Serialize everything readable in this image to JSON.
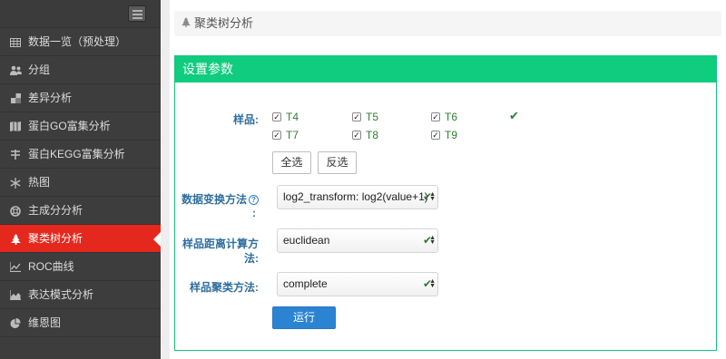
{
  "sidebar": {
    "toggle_icon": "menu-icon",
    "items": [
      {
        "label": "数据一览（预处理）",
        "icon": "table-icon"
      },
      {
        "label": "分组",
        "icon": "users-icon"
      },
      {
        "label": "差异分析",
        "icon": "puzzle-icon"
      },
      {
        "label": "蛋白GO富集分析",
        "icon": "map-icon"
      },
      {
        "label": "蛋白KEGG富集分析",
        "icon": "pathway-icon"
      },
      {
        "label": "热图",
        "icon": "snowflake-icon"
      },
      {
        "label": "主成分分析",
        "icon": "lifebuoy-icon"
      },
      {
        "label": "聚类树分析",
        "icon": "tree-icon",
        "active": true
      },
      {
        "label": "ROC曲线",
        "icon": "line-chart-icon"
      },
      {
        "label": "表达模式分析",
        "icon": "area-chart-icon"
      },
      {
        "label": "维恩图",
        "icon": "pie-chart-icon"
      }
    ]
  },
  "breadcrumb": {
    "icon": "tree-icon",
    "label": "聚类树分析"
  },
  "panel": {
    "title": "设置参数"
  },
  "form": {
    "samples_label": "样品:",
    "samples": [
      {
        "name": "T4",
        "checked": true
      },
      {
        "name": "T5",
        "checked": true
      },
      {
        "name": "T6",
        "checked": true
      },
      {
        "name": "T7",
        "checked": true
      },
      {
        "name": "T8",
        "checked": true
      },
      {
        "name": "T9",
        "checked": true
      }
    ],
    "select_all": "全选",
    "invert": "反选",
    "transform_label": "数据变换方法",
    "transform_label_tail": ":",
    "transform_value": "log2_transform: log2(value+1)",
    "distance_label": "样品距离计算方",
    "distance_label_tail": "法:",
    "distance_value": "euclidean",
    "cluster_label": "样品聚类方法:",
    "cluster_value": "complete",
    "run": "运行"
  },
  "colors": {
    "accent": "#0fcc7e",
    "active": "#e5281d",
    "primary": "#2b84d1",
    "check": "#2e7d32"
  }
}
